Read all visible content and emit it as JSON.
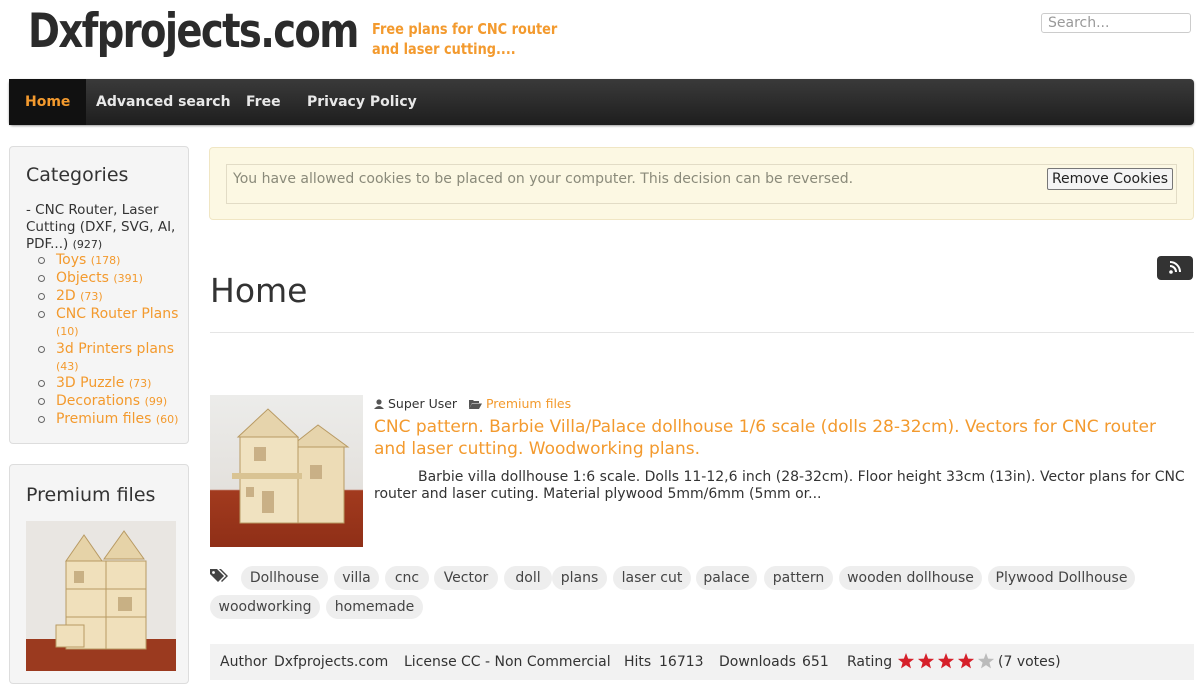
{
  "header": {
    "logo": "Dxfprojects.com",
    "tagline": "Free plans for CNC router and laser cutting....",
    "search_placeholder": "Search..."
  },
  "nav": {
    "items": [
      {
        "label": "Home",
        "active": true
      },
      {
        "label": "Advanced search"
      },
      {
        "label": "Free"
      },
      {
        "label": "Privacy Policy"
      }
    ]
  },
  "sidebar": {
    "categories": {
      "title": "Categories",
      "root_label": "- CNC Router, Laser Cutting (DXF, SVG, AI, PDF...)",
      "root_count": "(927)",
      "items": [
        {
          "label": "Toys",
          "count": "(178)"
        },
        {
          "label": "Objects",
          "count": "(391)"
        },
        {
          "label": "2D",
          "count": "(73)"
        },
        {
          "label": "CNC Router Plans",
          "count": "(10)"
        },
        {
          "label": "3d Printers plans",
          "count": "(43)"
        },
        {
          "label": "3D Puzzle",
          "count": "(73)"
        },
        {
          "label": "Decorations",
          "count": "(99)"
        },
        {
          "label": "Premium files",
          "count": "(60)"
        }
      ]
    },
    "premium": {
      "title": "Premium files"
    }
  },
  "cookie": {
    "message": "You have allowed cookies to be placed on your computer. This decision can be reversed.",
    "button": "Remove Cookies"
  },
  "page": {
    "title": "Home"
  },
  "article": {
    "author": "Super User",
    "category": "Premium files",
    "title": "CNC pattern. Barbie Villa/Palace dollhouse 1/6 scale (dolls 28-32cm). Vectors for CNC router and laser cutting. Woodworking plans.",
    "intro": "Barbie villa dollhouse 1:6 scale. Dolls 11-12,6 inch (28-32cm). Floor height 33cm (13in). Vector plans for CNC router and laser cuting. Material plywood 5mm/6mm (5mm or...",
    "tags": [
      "Dollhouse",
      "villa",
      "cnc",
      "Vector",
      "doll",
      "plans",
      "laser cut",
      "palace",
      "pattern",
      "wooden dollhouse",
      "Plywood Dollhouse",
      "woodworking",
      "homemade"
    ]
  },
  "footer": {
    "author_label": "Author",
    "author_value": "Dxfprojects.com",
    "license_label": "License",
    "license_value": "CC - Non Commercial",
    "hits_label": "Hits",
    "hits_value": "16713",
    "downloads_label": "Downloads",
    "downloads_value": "651",
    "rating_label": "Rating",
    "rating_stars": 4,
    "rating_max": 5,
    "votes": "(7 votes)"
  },
  "colors": {
    "accent": "#f39a2e",
    "star_filled": "#d6202a",
    "star_empty": "#bbbbbb"
  }
}
